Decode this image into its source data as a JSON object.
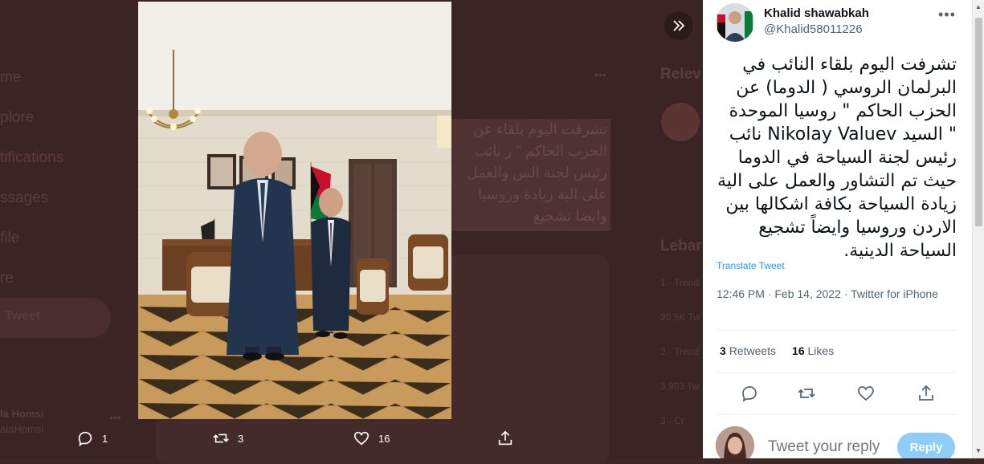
{
  "background_nav": {
    "items": [
      "me",
      "plore",
      "tifications",
      "ssages",
      "file",
      "re"
    ],
    "tweet_button": "Tweet",
    "account_name": "la Homsi",
    "account_handle": "alaHomsi"
  },
  "background_sidebar": {
    "relevant_heading": "Relev",
    "lebanon_heading": "Lebar",
    "trend_lines": [
      "1 · Trend",
      "20.5K Tw",
      "2 · Trend",
      "3,903 Tw",
      "3 · Cr"
    ]
  },
  "background_tweet_excerpt": "تشرفت اليوم بلقاء عن الحزب الحاكم \" ر نائب رئيس لجنة الس والعمل على الية زيادة وروسيا وايضا تشجيع",
  "media_actions": {
    "reply_count": "1",
    "retweet_count": "3",
    "like_count": "16"
  },
  "tweet": {
    "author_name": "Khalid shawabkah",
    "author_handle": "@Khalid58011226",
    "text": "تشرفت اليوم بلقاء النائب في البرلمان الروسي  ( الدوما) عن الحزب الحاكم \" روسيا الموحدة \" السيد Nikolay Valuev نائب رئيس لجنة السياحة في الدوما حيث تم التشاور والعمل على الية زيادة السياحة بكافة اشكالها بين الاردن وروسيا وايضاً تشجيع السياحة الدينية.",
    "translate_label": "Translate Tweet",
    "timestamp": "12:46 PM · Feb 14, 2022 · Twitter for iPhone",
    "retweets_count": "3",
    "retweets_label": "Retweets",
    "likes_count": "16",
    "likes_label": "Likes"
  },
  "reply": {
    "placeholder": "Tweet your reply",
    "button_label": "Reply"
  },
  "colors": {
    "accent": "#1d9bf0",
    "reply_button_disabled": "#8ecdf8",
    "overlay": "#3a2524"
  }
}
